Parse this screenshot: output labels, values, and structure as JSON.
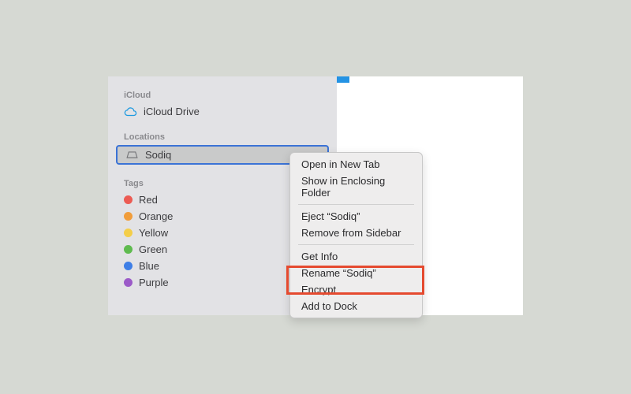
{
  "sidebar": {
    "icloud": {
      "header": "iCloud",
      "items": [
        {
          "label": "iCloud Drive",
          "icon": "cloud-icon"
        }
      ]
    },
    "locations": {
      "header": "Locations",
      "items": [
        {
          "label": "Sodiq",
          "icon": "disk-icon",
          "selected": true
        }
      ]
    },
    "tags": {
      "header": "Tags",
      "items": [
        {
          "label": "Red",
          "color": "#ec5b53"
        },
        {
          "label": "Orange",
          "color": "#f19d3b"
        },
        {
          "label": "Yellow",
          "color": "#f4ce49"
        },
        {
          "label": "Green",
          "color": "#5fbb4f"
        },
        {
          "label": "Blue",
          "color": "#3e7ee6"
        },
        {
          "label": "Purple",
          "color": "#9b5ac8"
        }
      ]
    }
  },
  "context_menu": {
    "groups": [
      [
        "Open in New Tab",
        "Show in Enclosing Folder"
      ],
      [
        "Eject “Sodiq”",
        "Remove from Sidebar"
      ],
      [
        "Get Info",
        "Rename “Sodiq”",
        "Encrypt",
        "Add to Dock"
      ]
    ]
  },
  "highlighted_item": "Encrypt",
  "colors": {
    "selection_border": "#3b73d6",
    "highlight_box": "#e54a2f"
  }
}
